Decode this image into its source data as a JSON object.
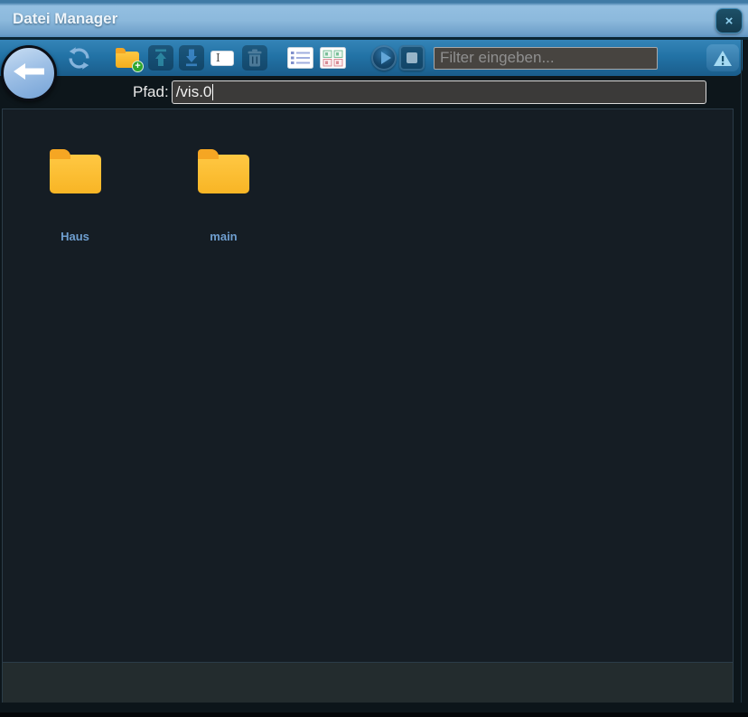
{
  "window": {
    "title": "Datei Manager",
    "close_glyph": "×"
  },
  "toolbar": {
    "filter_placeholder": "Filter eingeben...",
    "buttons": [
      {
        "name": "back",
        "enabled": true
      },
      {
        "name": "refresh",
        "enabled": true
      },
      {
        "name": "new-folder",
        "enabled": true
      },
      {
        "name": "upload",
        "enabled": false
      },
      {
        "name": "download",
        "enabled": false
      },
      {
        "name": "rename",
        "enabled": true
      },
      {
        "name": "delete",
        "enabled": false
      },
      {
        "name": "list-view",
        "enabled": true
      },
      {
        "name": "tile-view",
        "enabled": true
      },
      {
        "name": "play",
        "enabled": true
      },
      {
        "name": "stop",
        "enabled": false
      },
      {
        "name": "warning",
        "enabled": true
      }
    ]
  },
  "path_bar": {
    "label": "Pfad:",
    "value": "/vis.0"
  },
  "files": {
    "folders": [
      {
        "label": "Haus",
        "type": "folder"
      },
      {
        "label": "main",
        "type": "folder"
      }
    ]
  },
  "colors": {
    "titlebar_blue": "#8cb9dc",
    "toolbar_blue": "#2273a6",
    "folder_yellow": "#fcbb2f",
    "folder_tab_orange": "#f5a623",
    "folder_label_blue": "#6e9ecf",
    "content_bg": "#151d24",
    "input_bg": "#3b3a39",
    "accent_light_blue": "#8ecfee"
  }
}
